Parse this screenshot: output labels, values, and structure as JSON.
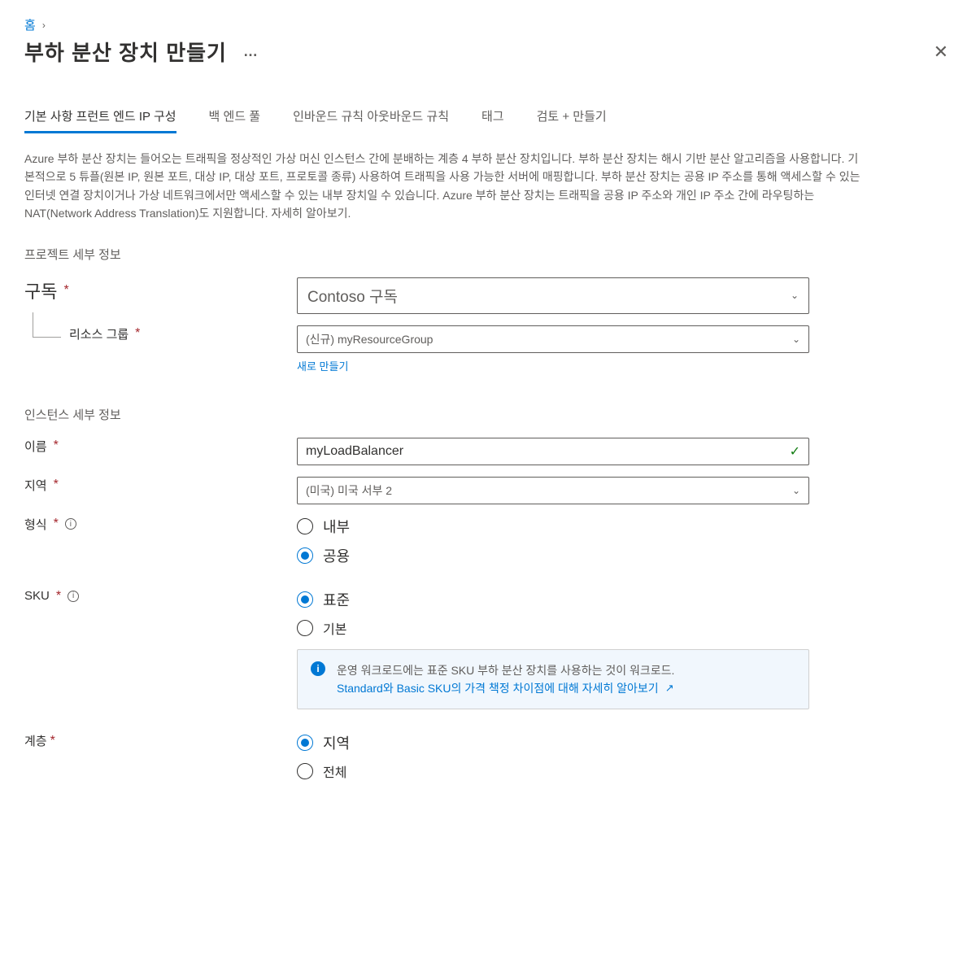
{
  "breadcrumb": {
    "home": "홈"
  },
  "header": {
    "title": "부하 분산 장치 만들기",
    "dots": "…"
  },
  "tabs": [
    {
      "label": "기본 사항 프런트 엔드 IP 구성",
      "active": true
    },
    {
      "label": "백 엔드 풀",
      "active": false
    },
    {
      "label": "인바운드 규칙 아웃바운드 규칙",
      "active": false
    },
    {
      "label": "태그",
      "active": false
    },
    {
      "label": "검토 + 만들기",
      "active": false
    }
  ],
  "description": "Azure 부하 분산 장치는 들어오는 트래픽을 정상적인 가상 머신 인스턴스 간에 분배하는 계층 4 부하 분산 장치입니다. 부하 분산 장치는 해시 기반 분산 알고리즘을 사용합니다. 기본적으로 5 튜플(원본 IP, 원본 포트, 대상 IP, 대상 포트, 프로토콜 종류) 사용하여 트래픽을 사용 가능한 서버에 매핑합니다. 부하 분산 장치는 공용 IP 주소를 통해 액세스할 수 있는 인터넷 연결 장치이거나 가상 네트워크에서만 액세스할 수 있는 내부 장치일 수 있습니다. Azure 부하 분산 장치는 트래픽을 공용 IP 주소와 개인 IP 주소 간에 라우팅하는 NAT(Network Address Translation)도 지원합니다. 자세히 알아보기.",
  "project": {
    "heading": "프로젝트 세부 정보",
    "subscription": {
      "label": "구독",
      "value": "Contoso 구독"
    },
    "resource_group": {
      "label": "리소스 그룹",
      "value": "(신규) myResourceGroup",
      "create_link": "새로 만들기"
    }
  },
  "instance": {
    "heading": "인스턴스 세부 정보",
    "name": {
      "label": "이름",
      "value": "myLoadBalancer"
    },
    "region": {
      "label": "지역",
      "value": "(미국) 미국 서부 2"
    },
    "type": {
      "label": "형식",
      "options": [
        {
          "label": "내부",
          "checked": false
        },
        {
          "label": "공용",
          "checked": true
        }
      ]
    },
    "sku": {
      "label": "SKU",
      "options": [
        {
          "label": "표준",
          "checked": true
        },
        {
          "label": "기본",
          "checked": false
        }
      ],
      "info": {
        "text": "운영 워크로드에는 표준 SKU 부하 분산 장치를 사용하는 것이 워크로드.",
        "link": "Standard와 Basic SKU의 가격 책정 차이점에 대해 자세히 알아보기"
      }
    },
    "tier": {
      "label": "계층",
      "options": [
        {
          "label": "지역",
          "checked": true
        },
        {
          "label": "전체",
          "checked": false
        }
      ]
    }
  }
}
